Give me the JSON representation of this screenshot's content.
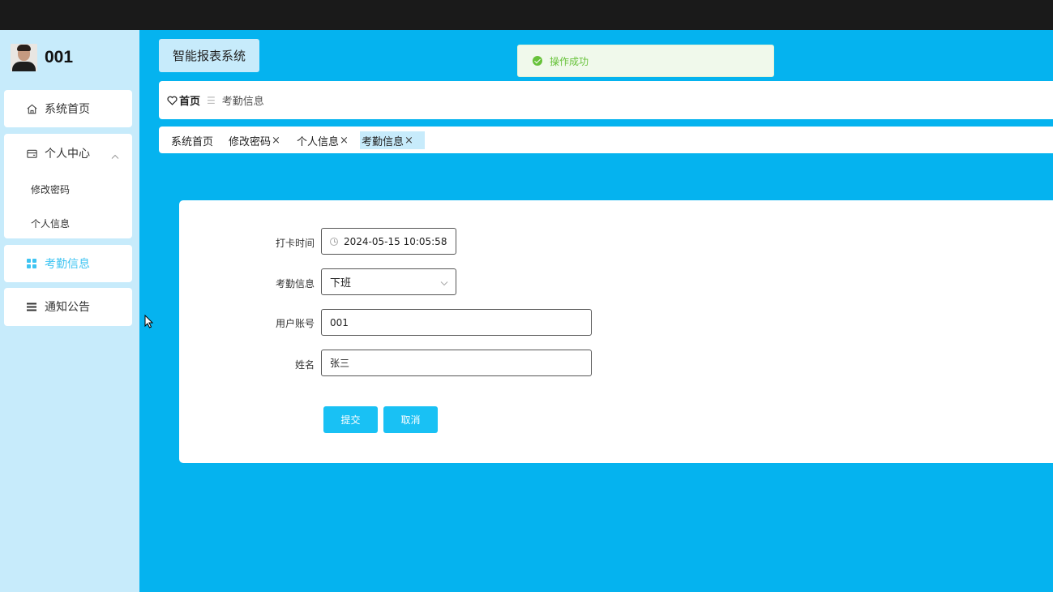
{
  "user": {
    "name": "001"
  },
  "sidebar": {
    "items": [
      {
        "label": "系统首页",
        "icon": "home-icon"
      },
      {
        "label": "个人中心",
        "icon": "wallet-icon",
        "expanded": true,
        "children": [
          {
            "label": "修改密码"
          },
          {
            "label": "个人信息"
          }
        ]
      },
      {
        "label": "考勤信息",
        "icon": "grid-icon",
        "active": true
      },
      {
        "label": "通知公告",
        "icon": "list-icon"
      }
    ]
  },
  "header": {
    "app_title": "智能报表系统"
  },
  "toast": {
    "message": "操作成功",
    "type": "success"
  },
  "breadcrumb": {
    "home": "首页",
    "current": "考勤信息"
  },
  "tabs": [
    {
      "label": "系统首页",
      "closable": false,
      "active": false
    },
    {
      "label": "修改密码",
      "closable": true,
      "active": false
    },
    {
      "label": "个人信息",
      "closable": true,
      "active": false
    },
    {
      "label": "考勤信息",
      "closable": true,
      "active": true
    }
  ],
  "form": {
    "punch_time": {
      "label": "打卡时间",
      "value": "2024-05-15 10:05:58"
    },
    "attendance": {
      "label": "考勤信息",
      "value": "下班"
    },
    "account": {
      "label": "用户账号",
      "value": "001"
    },
    "name": {
      "label": "姓名",
      "value": "张三"
    },
    "submit_label": "提交",
    "cancel_label": "取消"
  },
  "colors": {
    "main_bg": "#05b3ef",
    "sidebar_bg": "#c7ebfb",
    "accent": "#19c1f4",
    "active_menu_text": "#3ec4f2",
    "toast_green": "#67c23a"
  }
}
